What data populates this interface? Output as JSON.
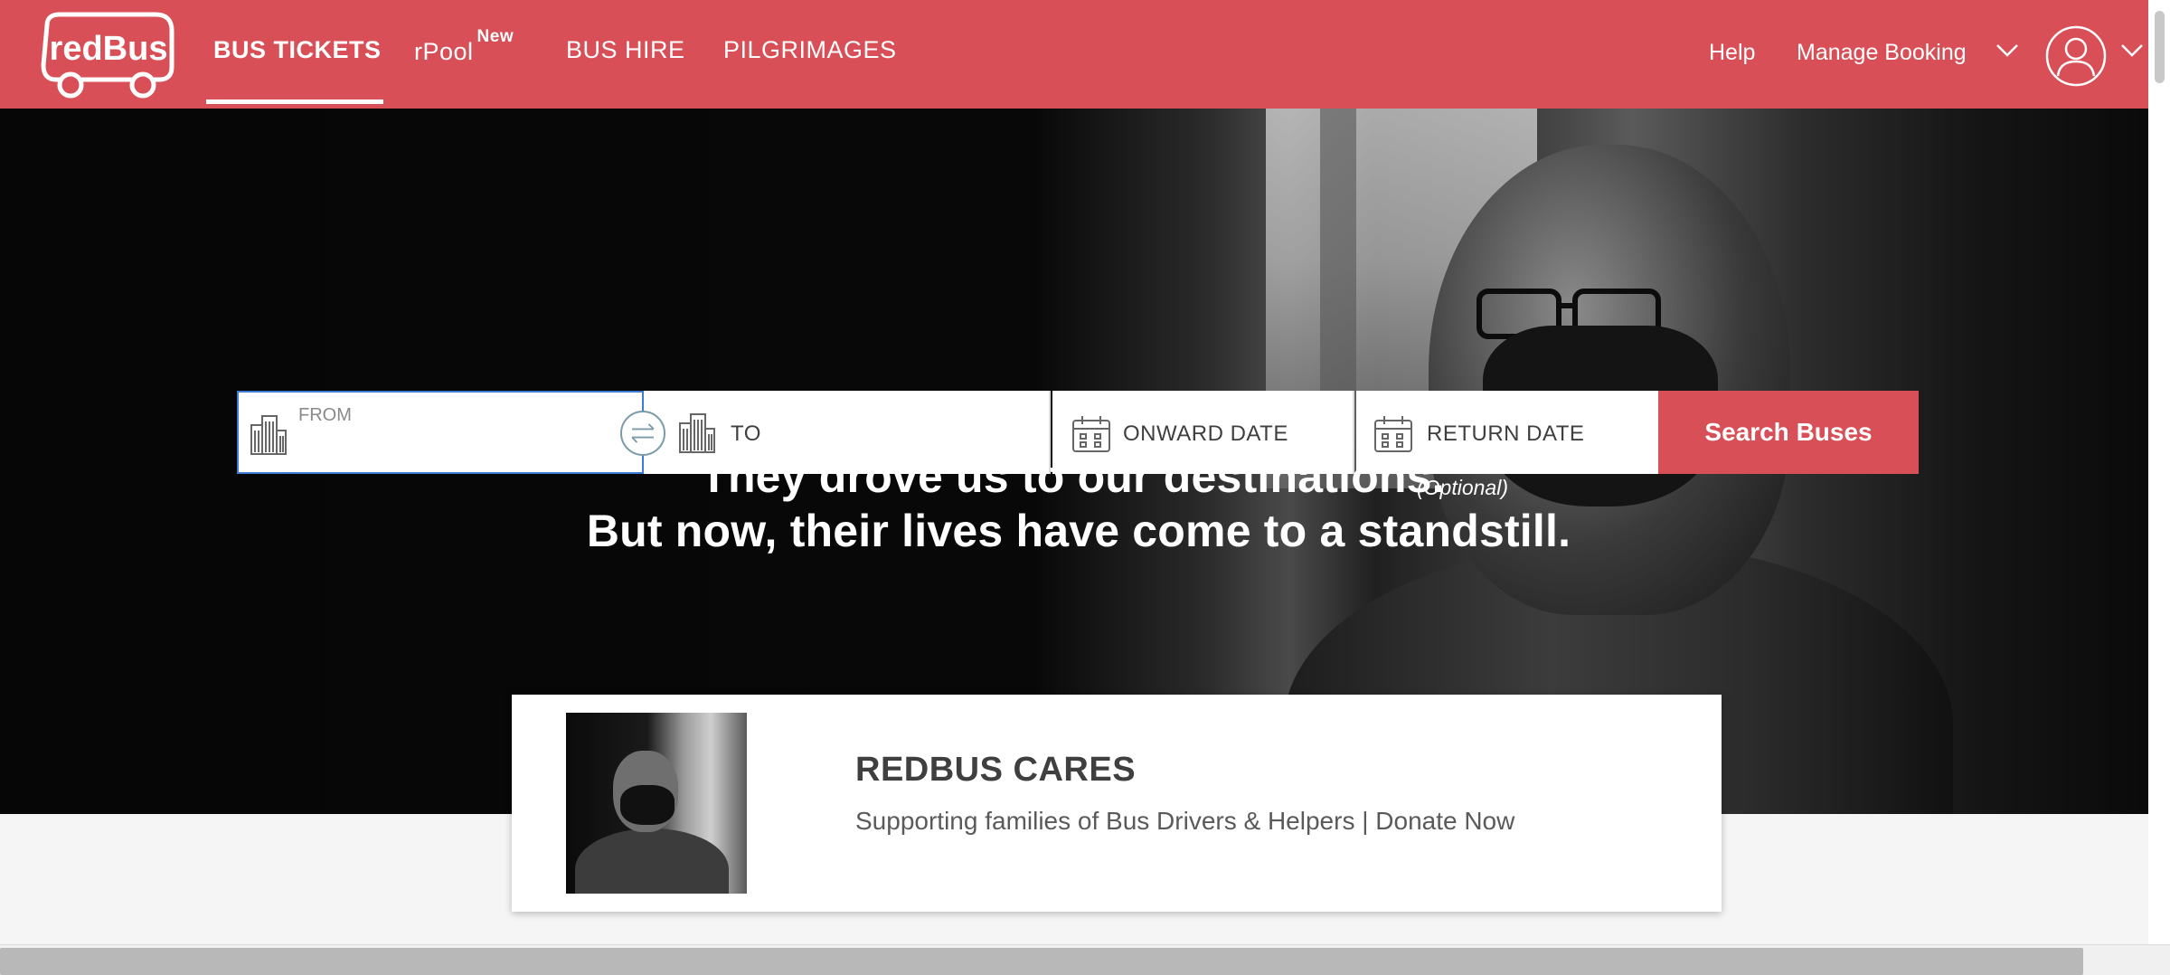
{
  "header": {
    "logo_text": "redBus",
    "nav": {
      "bus_tickets": "BUS TICKETS",
      "rpool": "rPool",
      "rpool_badge": "New",
      "bus_hire": "BUS HIRE",
      "pilgrimages": "PILGRIMAGES"
    },
    "help": "Help",
    "manage_booking": "Manage Booking"
  },
  "search": {
    "from_label": "FROM",
    "to_label": "TO",
    "onward_label": "ONWARD DATE",
    "return_label": "RETURN DATE",
    "return_hint": "(Optional)",
    "button": "Search Buses"
  },
  "hero": {
    "line1": "They drove us to our destinations.",
    "line2": "But now, their lives have come to a standstill."
  },
  "card": {
    "title": "REDBUS CARES",
    "subtitle": "Supporting families of Bus Drivers & Helpers | Donate Now"
  },
  "colors": {
    "brand": "#d84f57",
    "focus_border": "#3e7bd4"
  }
}
